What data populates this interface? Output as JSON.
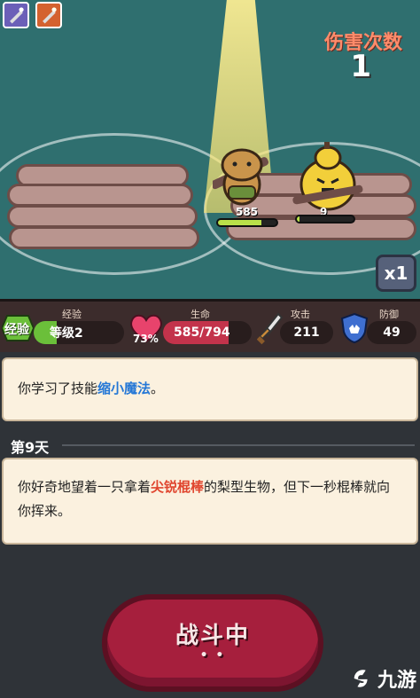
{
  "battle": {
    "damage_count_label": "伤害次数",
    "damage_count": "1",
    "speed_label": "x1",
    "player_hp": "585",
    "player_hp_fraction": 0.74,
    "enemy_hp": "9",
    "enemy_hp_fraction": 0.05
  },
  "stats": {
    "exp_badge": "经验",
    "exp_title": "经验",
    "level": "等级2",
    "exp_fraction": 0.25,
    "hp_title": "生命",
    "hp_percent": "73%",
    "hp_value": "585/794",
    "hp_fraction": 0.74,
    "atk_title": "攻击",
    "atk_value": "211",
    "def_title": "防御",
    "def_value": "49"
  },
  "log": {
    "learned_prefix": "你学习了技能",
    "learned_skill": "缩小魔法",
    "learned_suffix": "。",
    "day_label": "第9天",
    "event_part1": "你好奇地望着一只拿着",
    "event_weapon": "尖锐棍棒",
    "event_part2": "的梨型生物，但下一秒棍棒就向你挥来。"
  },
  "fight_button": {
    "label": "战斗中",
    "dots": "• •"
  },
  "watermark": {
    "text": "九游"
  },
  "colors": {
    "scene_bg": "#2f6f6f",
    "stat_bar": "#3c2c2c",
    "card_bg": "#fbf1df",
    "fight_button": "#a61f3d",
    "highlight_blue": "#2477d6",
    "highlight_red": "#e0452e"
  }
}
